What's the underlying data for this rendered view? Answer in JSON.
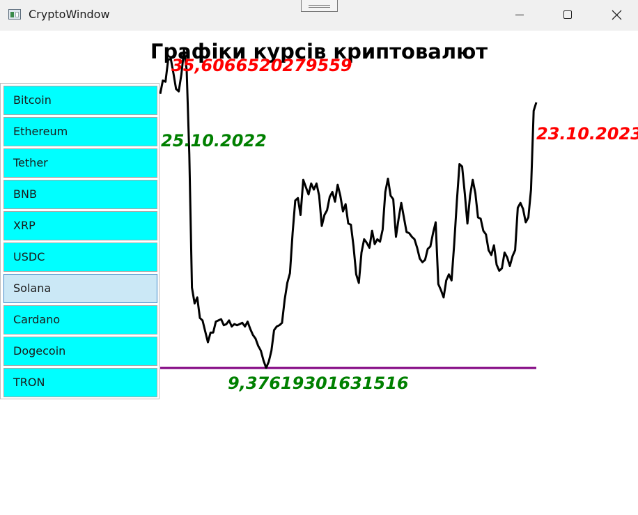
{
  "window": {
    "title": "CryptoWindow"
  },
  "chart_title": "Графіки курсів криптовалют",
  "coins": [
    "Bitcoin",
    "Ethereum",
    "Tether",
    "BNB",
    "XRP",
    "USDC",
    "Solana",
    "Cardano",
    "Dogecoin",
    "TRON"
  ],
  "selected_coin": "Solana",
  "labels": {
    "max_value": "35,6066520279559",
    "min_value": "9,37619301631516",
    "start_date": "25.10.2022",
    "end_date": "23.10.2023"
  },
  "colors": {
    "max_label": "#ff0000",
    "min_label": "#008000",
    "start_date_label": "#008000",
    "end_date_label": "#ff0000",
    "price_line": "#000000",
    "baseline": "#800080",
    "button_background": "#00ffff",
    "selected_button_background": "#cbe8f6"
  },
  "chart_data": {
    "type": "line",
    "title": "Графіки курсів криптовалют",
    "series": [
      {
        "name": "Solana",
        "values": [
          32.0,
          33.1,
          33.0,
          34.8,
          34.9,
          33.7,
          32.4,
          32.2,
          33.6,
          35.6,
          34.0,
          27.0,
          16.0,
          14.7,
          15.2,
          13.5,
          13.3,
          12.4,
          11.5,
          12.3,
          12.3,
          13.2,
          13.3,
          13.4,
          12.9,
          13.0,
          13.3,
          12.8,
          13.0,
          12.9,
          13.0,
          13.1,
          12.8,
          13.2,
          12.6,
          12.1,
          11.8,
          11.2,
          10.8,
          10.0,
          9.38,
          9.9,
          10.8,
          12.5,
          12.8,
          12.9,
          13.1,
          15.0,
          16.4,
          17.2,
          20.5,
          23.2,
          23.4,
          22.0,
          24.9,
          24.3,
          23.7,
          24.6,
          24.1,
          24.6,
          23.6,
          21.1,
          22.0,
          22.4,
          23.5,
          23.9,
          23.1,
          24.5,
          23.6,
          22.3,
          22.9,
          21.3,
          21.2,
          19.4,
          17.1,
          16.4,
          18.9,
          20.0,
          19.7,
          19.3,
          20.7,
          19.6,
          20.0,
          19.8,
          20.8,
          23.9,
          25.0,
          23.6,
          23.3,
          20.2,
          21.7,
          23.0,
          21.8,
          20.6,
          20.5,
          20.2,
          20.0,
          19.3,
          18.4,
          18.1,
          18.3,
          19.2,
          19.4,
          20.5,
          21.4,
          16.3,
          15.8,
          15.2,
          16.6,
          17.1,
          16.6,
          19.6,
          23.1,
          26.2,
          26.0,
          23.8,
          21.3,
          23.6,
          24.9,
          23.8,
          21.8,
          21.7,
          20.7,
          20.4,
          19.1,
          18.7,
          19.5,
          17.9,
          17.4,
          17.6,
          18.9,
          18.5,
          17.8,
          18.6,
          19.1,
          22.6,
          23.0,
          22.5,
          21.4,
          21.8,
          24.1,
          30.6,
          31.3
        ],
        "min": 9.37619301631516,
        "max": 35.6066520279559
      }
    ],
    "x_start": "25.10.2022",
    "x_end": "23.10.2023",
    "ylim": [
      9.37619301631516,
      35.6066520279559
    ]
  }
}
